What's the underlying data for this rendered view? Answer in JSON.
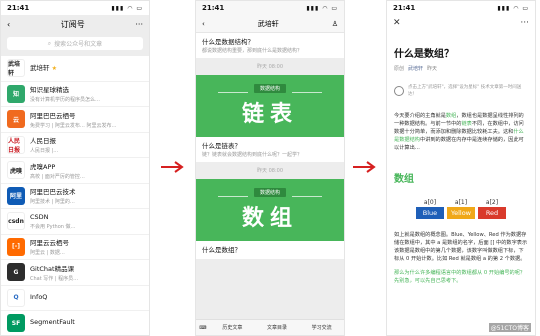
{
  "p1": {
    "time": "21:41",
    "title": "订阅号",
    "search_placeholder": "搜索公众号和文章",
    "items": [
      {
        "name": "武培轩",
        "sub": "",
        "color": "#ffffff",
        "fg": "#222222",
        "mark": "武培轩",
        "star": true
      },
      {
        "name": "知识星球精选",
        "sub": "没有计算机学历的程序员怎么…",
        "color": "#2fa86b",
        "fg": "#ffffff",
        "mark": "知",
        "star": false
      },
      {
        "name": "阿里巴巴云栖号",
        "sub": "免费学习 | 阿里云发布… 阿里云发布…",
        "color": "#f06a1f",
        "fg": "#ffffff",
        "mark": "云",
        "star": false
      },
      {
        "name": "人民日报",
        "sub": "人民日报 |…",
        "color": "#ffffff",
        "fg": "#c8161d",
        "mark": "人民日报",
        "star": false
      },
      {
        "name": "虎嗅APP",
        "sub": "高校 | 面对严厉的管控…",
        "color": "#ffffff",
        "fg": "#222222",
        "mark": "虎嗅",
        "star": false
      },
      {
        "name": "阿里巴巴云技术",
        "sub": "阿里技术 | 阿里的…",
        "color": "#0f5bb5",
        "fg": "#ffffff",
        "mark": "阿里",
        "star": false
      },
      {
        "name": "CSDN",
        "sub": "不会用 Python 做…",
        "color": "#ffffff",
        "fg": "#222222",
        "mark": "csdn",
        "star": false
      },
      {
        "name": "阿里云云栖号",
        "sub": "阿里云 | 数据…",
        "color": "#ff6a00",
        "fg": "#ffffff",
        "mark": "[-]",
        "star": false
      },
      {
        "name": "GitChat精品课",
        "sub": "Chat 写作 | 程序员…",
        "color": "#2d2d2d",
        "fg": "#ffffff",
        "mark": "G",
        "star": false
      },
      {
        "name": "InfoQ",
        "sub": "",
        "color": "#ffffff",
        "fg": "#2a6cc4",
        "mark": "Q",
        "star": false
      },
      {
        "name": "SegmentFault",
        "sub": "",
        "color": "#009a61",
        "fg": "#ffffff",
        "mark": "SF",
        "star": false
      }
    ]
  },
  "p2": {
    "time": "21:41",
    "title": "武培轩",
    "cards": [
      {
        "title": "什么是数据结构？",
        "sub": "都说数据结构重要，那到底什么是数据结构？",
        "ts": "昨天 08:00",
        "tag": "数据结构",
        "big": "链表",
        "show_banner": true
      },
      {
        "title": "什么是链表？",
        "sub": "链？链表就会数据结构到底什么呢？一起学？",
        "ts": "昨天 08:00",
        "tag": "数据结构",
        "big": "数组",
        "show_banner": true
      },
      {
        "title": "什么是数组？",
        "sub": "",
        "ts": "",
        "tag": "",
        "big": "",
        "show_banner": false
      }
    ],
    "bottom": [
      "历史文章",
      "文章目录",
      "学习交流"
    ]
  },
  "p3": {
    "time": "21:41",
    "title": "什么是数组？",
    "meta": "原创",
    "author": "武培轩",
    "date": "昨天",
    "quote": "点击上方\"武培轩\"，选择\"设为星标\" 技术文章第一时间送达！",
    "para_a": "今天要介绍的主角就是",
    "hl1": "数组",
    "para_b": "，数组也是数据呈线性排列的一种数据结构。与前一节中的",
    "hl2": "链表",
    "para_c": "不同，在数组中，访问数据十分简单，而添加和删除数据比较耗工夫。这和",
    "hl3": "什么是数据结构",
    "para_d": "中讲到的数据在内存中是连续存储的，因此可以计算出…",
    "h2": "数组",
    "cells": [
      {
        "idx": "a[0]",
        "val": "Blue",
        "color": "#1e5fb8"
      },
      {
        "idx": "a[1]",
        "val": "Yellow",
        "color": "#f0a818"
      },
      {
        "idx": "a[2]",
        "val": "Red",
        "color": "#d93a2b"
      }
    ],
    "para2": "如上就是数组的概念图。Blue、Yellow、Red 作为数据存储在数组中，其中 a 是数组的名字，后面 [] 中的数字表示该数据是数组中的第几个数据，该数字叫做数组下标，下标从 0 开始计数。比如 Red 就是数组 a 的第 2 个数据。",
    "para3": "那么为什么许多编程语言中的数组都从 0 开始编号的呢？先别急，可以先自己思考下。",
    "watermark": "@51CTO博客"
  }
}
